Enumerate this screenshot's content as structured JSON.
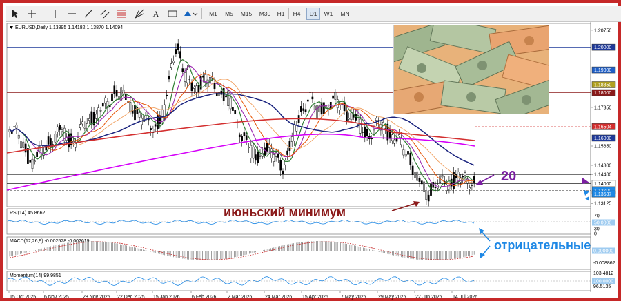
{
  "toolbar": {
    "timeframes": [
      "M1",
      "M5",
      "M15",
      "M30",
      "H1",
      "H4",
      "D1",
      "W1",
      "MN"
    ],
    "active_timeframe": "D1"
  },
  "chart": {
    "symbol_header": "EURUSD,Daily  1.13895 1.14182 1.13870 1.14094",
    "annotation_main": "июньский минимум",
    "annotation_num": "20",
    "annotation_neg": "отрицательные"
  },
  "price_scale": {
    "labels": [
      "1.20750",
      "1.20000",
      "1.19000",
      "1.18350",
      "1.18000",
      "1.17350",
      "1.16504",
      "1.16000",
      "1.15650",
      "1.14800",
      "1.14400",
      "1.14000",
      "1.13700",
      "1.13537",
      "1.13125"
    ],
    "boxed": {
      "1.20000": "#1f3a9a",
      "1.19000": "#1f5fc8",
      "1.18350": "#b0a020",
      "1.18000": "#8b1a1a",
      "1.16504": "#d32f2f",
      "1.16000": "#1f3a9a",
      "1.14000": "#ffffff",
      "1.13700": "#1e88e5",
      "1.13537": "#1e88e5"
    }
  },
  "rsi": {
    "label": "RSI(14) 45.8662",
    "levels": [
      "70",
      "50.0000",
      "30",
      "0"
    ]
  },
  "macd": {
    "label": "MACD(12,26,9) -0.002528 -0.002619",
    "levels": [
      "0.000000",
      "-0.008862"
    ]
  },
  "momentum": {
    "label": "Momentum(14) 99.9851",
    "levels": [
      "103.4812",
      "100.0000",
      "96.5135"
    ]
  },
  "date_axis": [
    "15 Oct 2025",
    "6 Nov 2025",
    "28 Nov 2025",
    "22 Dec 2025",
    "15 Jan 2026",
    "6 Feb 2026",
    "2 Mar 2026",
    "24 Mar 2026",
    "15 Apr 2026",
    "7 May 2026",
    "29 May 2026",
    "22 Jun 2026",
    "14 Jul 2026"
  ],
  "colors": {
    "candle_up": "#ffffff",
    "candle_down": "#000000",
    "ma_red": "#d32f2f",
    "ma_blue": "#1a237e",
    "ma_magenta": "#d500f9",
    "ma_green": "#2e7d32",
    "ma_orange": "#e65100",
    "annotation_dark": "#8b1a1a",
    "annotation_purple": "#7b1fa2",
    "annotation_blue": "#1e88e5"
  }
}
